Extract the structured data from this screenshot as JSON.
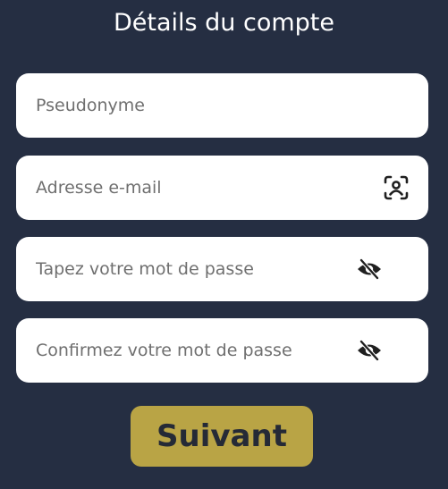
{
  "form": {
    "title": "Détails du compte",
    "fields": [
      {
        "placeholder": "Pseudonyme",
        "value": ""
      },
      {
        "placeholder": "Adresse e-mail",
        "value": "",
        "icon": "contact-scan-icon"
      },
      {
        "placeholder": "Tapez votre mot de passe",
        "value": "",
        "icon": "eye-slash-icon"
      },
      {
        "placeholder": "Confirmez votre mot de passe",
        "value": "",
        "icon": "eye-slash-icon"
      }
    ],
    "next_label": "Suivant"
  },
  "colors": {
    "background": "#252e42",
    "field_bg": "#ffffff",
    "placeholder": "#6f6f6f",
    "button_bg": "#b9a445",
    "button_text": "#252a36",
    "icon": "#1f1f1f"
  }
}
